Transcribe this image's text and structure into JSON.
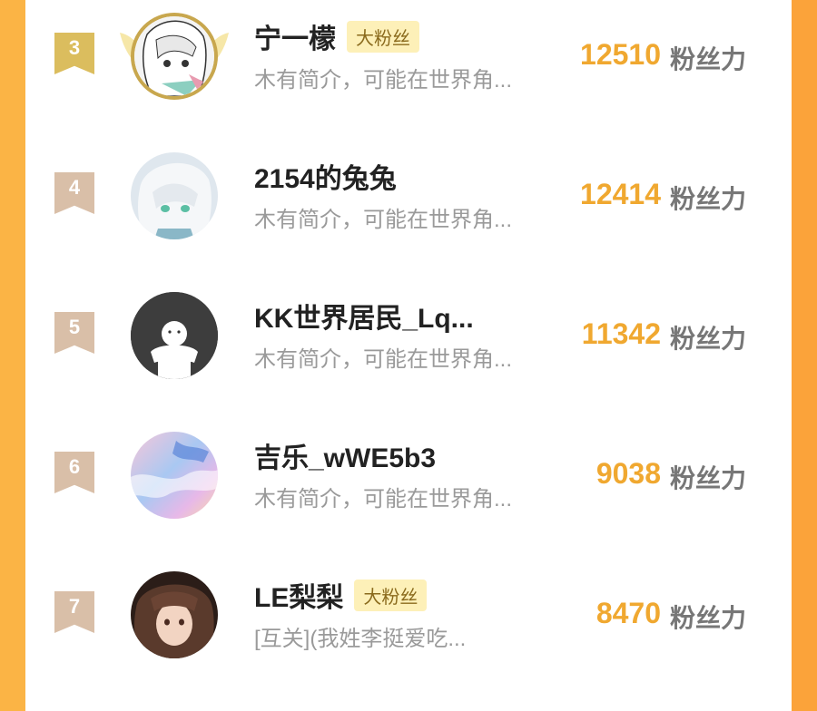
{
  "rows": [
    {
      "rank": "3",
      "name": "宁一檬",
      "badge": "大粉丝",
      "bio": "木有简介，可能在世界角...",
      "score": "12510",
      "unit": "粉丝力",
      "avatar": "anime-girl-avatar"
    },
    {
      "rank": "4",
      "name": "2154的兔兔",
      "badge": "",
      "bio": "木有简介，可能在世界角...",
      "score": "12414",
      "unit": "粉丝力",
      "avatar": "white-hair-girl-avatar"
    },
    {
      "rank": "5",
      "name": "KK世界居民_Lq...",
      "badge": "",
      "bio": "木有简介，可能在世界角...",
      "score": "11342",
      "unit": "粉丝力",
      "avatar": "default-ghost-avatar"
    },
    {
      "rank": "6",
      "name": "吉乐_wWE5b3",
      "badge": "",
      "bio": "木有简介，可能在世界角...",
      "score": "9038",
      "unit": "粉丝力",
      "avatar": "pastel-sky-avatar"
    },
    {
      "rank": "7",
      "name": "LE梨梨",
      "badge": "大粉丝",
      "bio": "[互关](我姓李挺爱吃...",
      "score": "8470",
      "unit": "粉丝力",
      "avatar": "brown-hair-girl-avatar"
    }
  ],
  "colors": {
    "score": "#f0a830",
    "badge_bg": "#fdf0b8",
    "rank_gold": "#dbbd5e",
    "rank_bronze": "#d9bfa8"
  }
}
